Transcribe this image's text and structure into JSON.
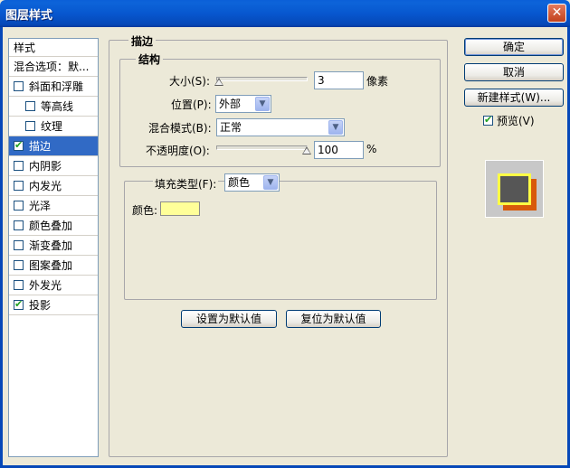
{
  "window": {
    "title": "图层样式",
    "close_glyph": "✕"
  },
  "style_list": {
    "header": "样式",
    "blend_options": "混合选项：默...",
    "items": [
      {
        "label": "斜面和浮雕",
        "checked": false,
        "indent": false,
        "selected": false
      },
      {
        "label": "等高线",
        "checked": false,
        "indent": true,
        "selected": false
      },
      {
        "label": "纹理",
        "checked": false,
        "indent": true,
        "selected": false
      },
      {
        "label": "描边",
        "checked": true,
        "indent": false,
        "selected": true
      },
      {
        "label": "内阴影",
        "checked": false,
        "indent": false,
        "selected": false
      },
      {
        "label": "内发光",
        "checked": false,
        "indent": false,
        "selected": false
      },
      {
        "label": "光泽",
        "checked": false,
        "indent": false,
        "selected": false
      },
      {
        "label": "颜色叠加",
        "checked": false,
        "indent": false,
        "selected": false
      },
      {
        "label": "渐变叠加",
        "checked": false,
        "indent": false,
        "selected": false
      },
      {
        "label": "图案叠加",
        "checked": false,
        "indent": false,
        "selected": false
      },
      {
        "label": "外发光",
        "checked": false,
        "indent": false,
        "selected": false
      },
      {
        "label": "投影",
        "checked": true,
        "indent": false,
        "selected": false
      }
    ]
  },
  "stroke": {
    "group_title": "描边",
    "structure_title": "结构",
    "size_label": "大小(S):",
    "size_value": "3",
    "size_unit": "像素",
    "position_label": "位置(P):",
    "position_value": "外部",
    "blend_label": "混合模式(B):",
    "blend_value": "正常",
    "opacity_label": "不透明度(O):",
    "opacity_value": "100",
    "opacity_unit": "%",
    "fill_type_label": "填充类型(F):",
    "fill_type_value": "颜色",
    "color_label": "颜色:",
    "color_hex": "#ffff99"
  },
  "buttons": {
    "ok": "确定",
    "cancel": "取消",
    "new_style": "新建样式(W)...",
    "preview_label": "预览(V)",
    "set_default": "设置为默认值",
    "reset_default": "复位为默认值"
  },
  "colors": {
    "title_bar": "#0757cf",
    "selection": "#316ac5",
    "stroke_preview": "#ffff44",
    "shadow_preview": "#d85a0b"
  }
}
